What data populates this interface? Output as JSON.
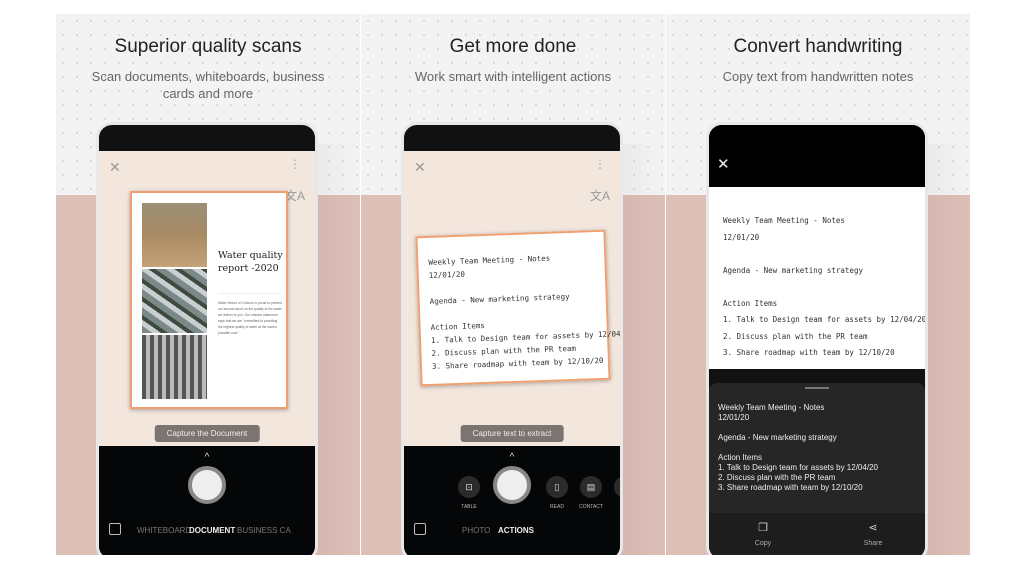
{
  "panels": [
    {
      "title": "Superior quality scans",
      "subtitle": "Scan documents, whiteboards, business cards and more"
    },
    {
      "title": "Get more done",
      "subtitle": "Work smart with intelligent actions"
    },
    {
      "title": "Convert handwriting",
      "subtitle": "Copy text from handwritten notes"
    }
  ],
  "phone1": {
    "doc_title_1": "Water quality",
    "doc_title_2": "report -2020",
    "doc_body": "Water Works of Contoso is proud to present our annual report on the quality of the water we deliver to you. Our mission statement says that we are \"committed to providing the highest quality of water at the lowest possible cost.\"",
    "hint": "Capture the Document",
    "modes": [
      "WHITEBOARD",
      "DOCUMENT",
      "BUSINESS CA"
    ]
  },
  "phone2": {
    "hint": "Capture text to extract",
    "actions": [
      "TABLE",
      "READ",
      "CONTACT",
      "QR"
    ],
    "modes": [
      "PHOTO",
      "ACTIONS"
    ]
  },
  "notes": {
    "title": "Weekly Team Meeting - Notes",
    "date": "12/01/20",
    "agenda": "Agenda - New marketing strategy",
    "heading": "Action Items",
    "items": [
      "1. Talk to Design team for assets by 12/04/20",
      "2. Discuss plan with the PR team",
      "3. Share roadmap with team by 12/10/20"
    ]
  },
  "phone3": {
    "copy_label": "Copy",
    "share_label": "Share"
  },
  "colors": {
    "accent_border": "#f0a070",
    "pink_bg": "#dcbfb7"
  }
}
